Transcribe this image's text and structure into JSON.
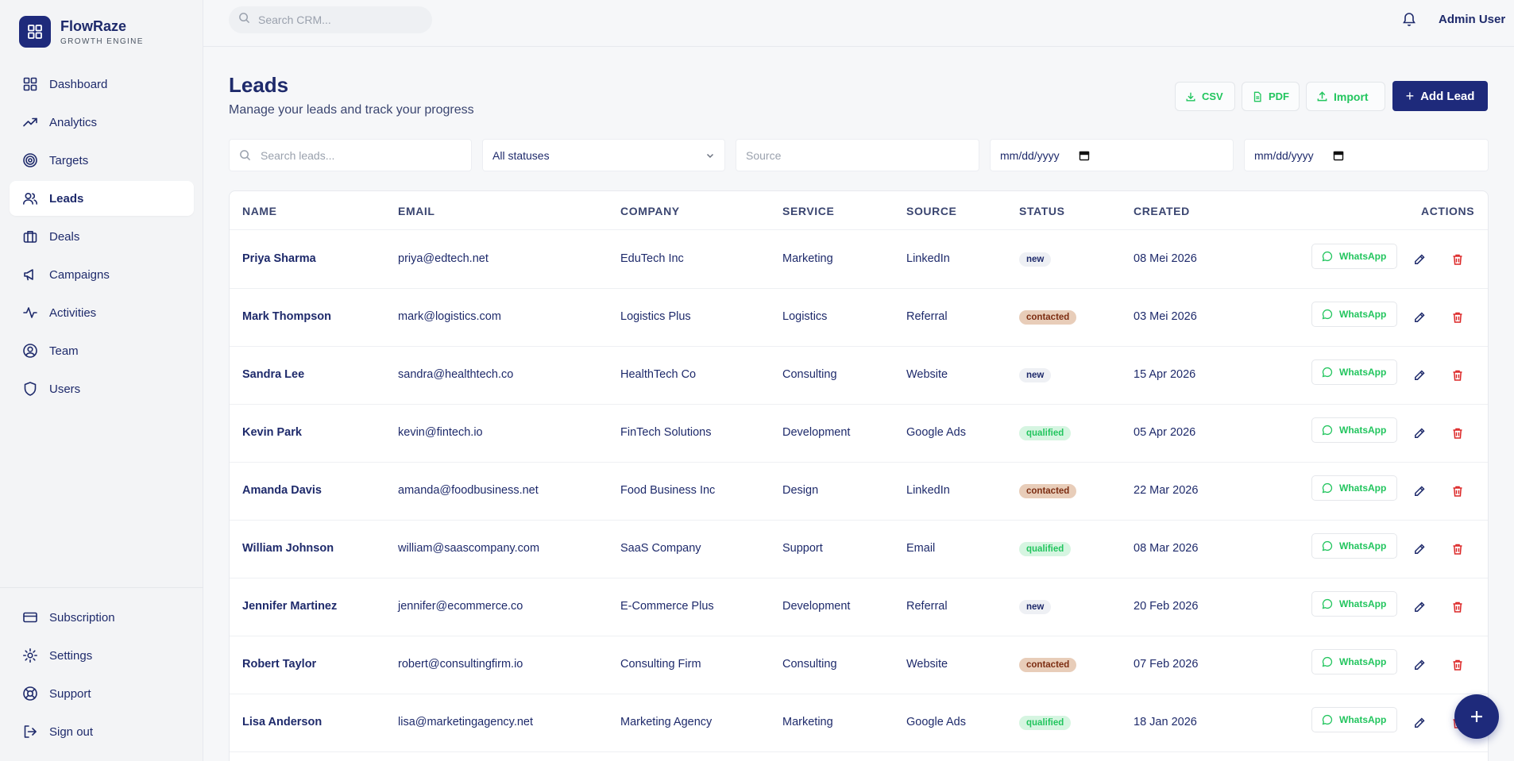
{
  "brand": {
    "name": "FlowRaze",
    "tagline": "GROWTH ENGINE"
  },
  "sidebar": {
    "items": [
      {
        "label": "Dashboard",
        "icon": "dashboard-icon"
      },
      {
        "label": "Analytics",
        "icon": "trend-up-icon"
      },
      {
        "label": "Targets",
        "icon": "target-icon"
      },
      {
        "label": "Leads",
        "icon": "users-icon",
        "active": true
      },
      {
        "label": "Deals",
        "icon": "briefcase-icon"
      },
      {
        "label": "Campaigns",
        "icon": "megaphone-icon"
      },
      {
        "label": "Activities",
        "icon": "activity-icon"
      },
      {
        "label": "Team",
        "icon": "user-circle-icon"
      },
      {
        "label": "Users",
        "icon": "shield-icon"
      }
    ],
    "bottom": [
      {
        "label": "Subscription",
        "icon": "credit-card-icon"
      },
      {
        "label": "Settings",
        "icon": "gear-icon"
      },
      {
        "label": "Support",
        "icon": "lifebuoy-icon"
      },
      {
        "label": "Sign out",
        "icon": "sign-out-icon"
      }
    ]
  },
  "topbar": {
    "search_placeholder": "Search CRM...",
    "user": "Admin User"
  },
  "header": {
    "title": "Leads",
    "subtitle": "Manage your leads and track your progress",
    "csv": "CSV",
    "pdf": "PDF",
    "import": "Import",
    "add": "Add Lead"
  },
  "filters": {
    "search_placeholder": "Search leads...",
    "status": "All statuses",
    "source_placeholder": "Source",
    "date_from": "mm/dd/yyyy",
    "date_to": "mm/dd/yyyy"
  },
  "table": {
    "columns": [
      "NAME",
      "EMAIL",
      "COMPANY",
      "SERVICE",
      "SOURCE",
      "STATUS",
      "CREATED",
      "ACTIONS"
    ],
    "whatsapp_label": "WhatsApp",
    "rows": [
      {
        "name": "Priya Sharma",
        "email": "priya@edtech.net",
        "company": "EduTech Inc",
        "service": "Marketing",
        "source": "LinkedIn",
        "status": "new",
        "created": "08 Mei 2026"
      },
      {
        "name": "Mark Thompson",
        "email": "mark@logistics.com",
        "company": "Logistics Plus",
        "service": "Logistics",
        "source": "Referral",
        "status": "contacted",
        "created": "03 Mei 2026"
      },
      {
        "name": "Sandra Lee",
        "email": "sandra@healthtech.co",
        "company": "HealthTech Co",
        "service": "Consulting",
        "source": "Website",
        "status": "new",
        "created": "15 Apr 2026"
      },
      {
        "name": "Kevin Park",
        "email": "kevin@fintech.io",
        "company": "FinTech Solutions",
        "service": "Development",
        "source": "Google Ads",
        "status": "qualified",
        "created": "05 Apr 2026"
      },
      {
        "name": "Amanda Davis",
        "email": "amanda@foodbusiness.net",
        "company": "Food Business Inc",
        "service": "Design",
        "source": "LinkedIn",
        "status": "contacted",
        "created": "22 Mar 2026"
      },
      {
        "name": "William Johnson",
        "email": "william@saascompany.com",
        "company": "SaaS Company",
        "service": "Support",
        "source": "Email",
        "status": "qualified",
        "created": "08 Mar 2026"
      },
      {
        "name": "Jennifer Martinez",
        "email": "jennifer@ecommerce.co",
        "company": "E-Commerce Plus",
        "service": "Development",
        "source": "Referral",
        "status": "new",
        "created": "20 Feb 2026"
      },
      {
        "name": "Robert Taylor",
        "email": "robert@consultingfirm.io",
        "company": "Consulting Firm",
        "service": "Consulting",
        "source": "Website",
        "status": "contacted",
        "created": "07 Feb 2026"
      },
      {
        "name": "Lisa Anderson",
        "email": "lisa@marketingagency.net",
        "company": "Marketing Agency",
        "service": "Marketing",
        "source": "Google Ads",
        "status": "qualified",
        "created": "18 Jan 2026"
      }
    ]
  },
  "colors": {
    "primary": "#1e2a7b",
    "success": "#22c55e",
    "danger": "#dc2626"
  }
}
